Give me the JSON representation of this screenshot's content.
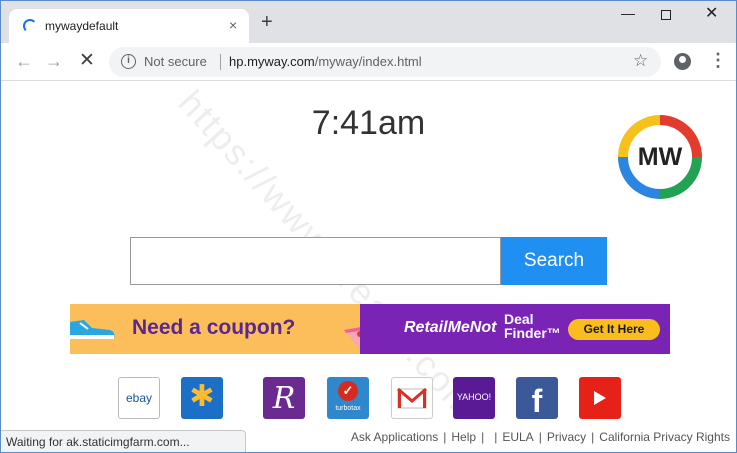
{
  "browser": {
    "tab_title": "mywaydefault",
    "tab_close": "×",
    "new_tab": "+",
    "window_controls": {
      "minimize": "—",
      "close": "✕"
    },
    "nav": {
      "back": "←",
      "forward": "→",
      "stop": "✕"
    },
    "security_label": "Not secure",
    "url_host": "hp.myway.com",
    "url_path": "/myway/index.html",
    "star": "☆",
    "menu": "⋮"
  },
  "page": {
    "watermark": "https://www.greatis.com",
    "clock": "7:41am",
    "logo_text": "MW",
    "search_button": "Search",
    "search_value": "",
    "banner": {
      "coupon_text": "Need a coupon?",
      "brand_text": "RetailMeNot",
      "deal_line1": "Deal",
      "deal_line2": "Finder™",
      "cta": "Get It Here"
    },
    "shortcuts": {
      "ebay": "ebay",
      "walmart": "✱",
      "rakuten": "R",
      "turbotax_check": "✓",
      "turbotax": "turbotax",
      "yahoo": "YAHOO!",
      "facebook": "f"
    },
    "footer_links": [
      "Ask Applications",
      "Help",
      "",
      "EULA",
      "Privacy",
      "California Privacy Rights"
    ],
    "status_text": "Waiting for ak.staticimgfarm.com..."
  },
  "colors": {
    "search_button": "#1f8ff2",
    "banner_yellow": "#fbbe5b",
    "banner_purple": "#7a24b5"
  }
}
